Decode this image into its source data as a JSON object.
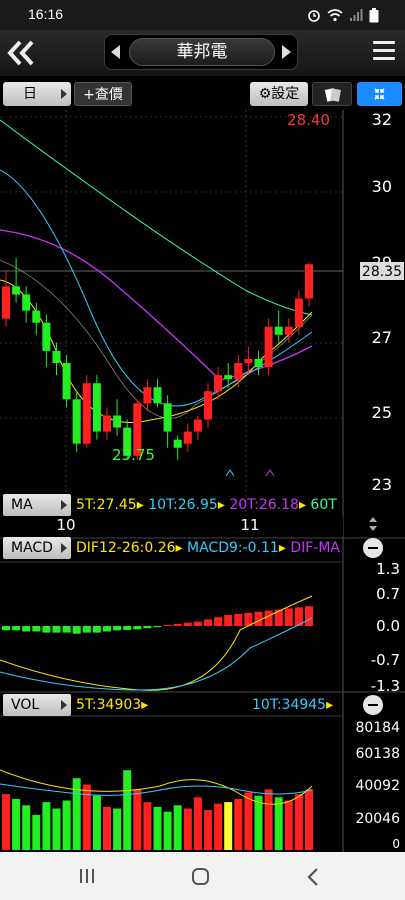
{
  "status": {
    "time": "16:16"
  },
  "header": {
    "stock_name": "華邦電"
  },
  "toolbar": {
    "period": "日",
    "query": "+查價",
    "settings": "設定"
  },
  "main": {
    "high_label": "28.40",
    "low_label": "23.75",
    "current_price": "28.35",
    "y_ticks": [
      "32",
      "30",
      "29",
      "27",
      "25",
      "23"
    ],
    "x_ticks": [
      "10",
      "11"
    ]
  },
  "ma": {
    "tag": "MA",
    "legend": [
      {
        "text": "5T:27.45",
        "color": "#ffe600"
      },
      {
        "text": "10T:26.95",
        "color": "#33ccff"
      },
      {
        "text": "20T:26.18",
        "color": "#cc33ff"
      },
      {
        "text": "60T",
        "color": "#33ff99"
      }
    ]
  },
  "macd": {
    "tag": "MACD",
    "legend": [
      {
        "text": "DIF12-26:0.26",
        "color": "#ffe600"
      },
      {
        "text": "MACD9:-0.11",
        "color": "#33ccff"
      },
      {
        "text": "DIF-MA",
        "color": "#cc33ff"
      }
    ],
    "y_ticks": [
      "1.3",
      "0.7",
      "0.0",
      "-0.7",
      "-1.3"
    ]
  },
  "vol": {
    "tag": "VOL",
    "legend": [
      {
        "text": "5T:34903",
        "color": "#ffe600"
      },
      {
        "text": "10T:34945",
        "color": "#33ccff"
      }
    ],
    "y_ticks": [
      "80184",
      "60138",
      "40092",
      "20046",
      "0"
    ]
  },
  "chart_data": {
    "type": "candlestick",
    "up_color": "#ff2020",
    "down_color": "#22ee22",
    "ylim": [
      22.5,
      32.5
    ],
    "candles": [
      [
        27.0,
        27.8,
        26.8,
        28.2
      ],
      [
        27.8,
        27.6,
        27.4,
        28.5
      ],
      [
        27.6,
        27.2,
        26.9,
        27.8
      ],
      [
        27.2,
        26.9,
        26.6,
        27.4
      ],
      [
        26.9,
        26.2,
        25.8,
        27.1
      ],
      [
        26.2,
        25.9,
        25.6,
        26.4
      ],
      [
        25.9,
        25.0,
        24.8,
        26.1
      ],
      [
        25.0,
        23.9,
        23.7,
        25.2
      ],
      [
        23.9,
        25.4,
        23.8,
        25.6
      ],
      [
        25.4,
        24.2,
        24.0,
        25.6
      ],
      [
        24.2,
        24.6,
        24.0,
        24.8
      ],
      [
        24.6,
        24.3,
        24.1,
        25.0
      ],
      [
        24.3,
        23.6,
        23.5,
        24.5
      ],
      [
        23.6,
        24.9,
        23.5,
        25.0
      ],
      [
        24.9,
        25.3,
        24.7,
        25.5
      ],
      [
        25.3,
        24.9,
        24.8,
        25.5
      ],
      [
        24.9,
        24.2,
        23.8,
        25.1
      ],
      [
        24.0,
        23.8,
        23.5,
        24.1
      ],
      [
        23.9,
        24.2,
        23.7,
        24.4
      ],
      [
        24.2,
        24.5,
        24.0,
        24.6
      ],
      [
        24.5,
        25.2,
        24.3,
        25.4
      ],
      [
        25.2,
        25.6,
        25.0,
        25.8
      ],
      [
        25.6,
        25.5,
        25.3,
        25.9
      ],
      [
        25.5,
        25.9,
        25.3,
        26.1
      ],
      [
        25.9,
        26.0,
        25.6,
        26.3
      ],
      [
        26.0,
        25.8,
        25.6,
        26.2
      ],
      [
        25.8,
        26.8,
        25.6,
        27.0
      ],
      [
        26.8,
        26.6,
        26.4,
        27.2
      ],
      [
        26.6,
        26.8,
        26.4,
        27.0
      ],
      [
        26.8,
        27.5,
        26.6,
        27.7
      ],
      [
        27.5,
        28.35,
        27.3,
        28.4
      ]
    ],
    "volume": [
      35000,
      32000,
      28000,
      22000,
      30000,
      26000,
      31000,
      45000,
      41000,
      34000,
      27000,
      26000,
      50000,
      38000,
      30000,
      27000,
      24000,
      28000,
      26000,
      33000,
      25000,
      29000,
      30000,
      32000,
      36000,
      34000,
      38000,
      33000,
      31000,
      35000,
      38000
    ],
    "macd_hist": [
      -0.2,
      -0.2,
      -0.25,
      -0.25,
      -0.3,
      -0.3,
      -0.3,
      -0.35,
      -0.3,
      -0.3,
      -0.25,
      -0.2,
      -0.18,
      -0.15,
      -0.1,
      -0.05,
      0.05,
      0.1,
      0.15,
      0.2,
      0.3,
      0.4,
      0.5,
      0.55,
      0.6,
      0.65,
      0.7,
      0.75,
      0.8,
      0.85,
      0.9
    ]
  }
}
